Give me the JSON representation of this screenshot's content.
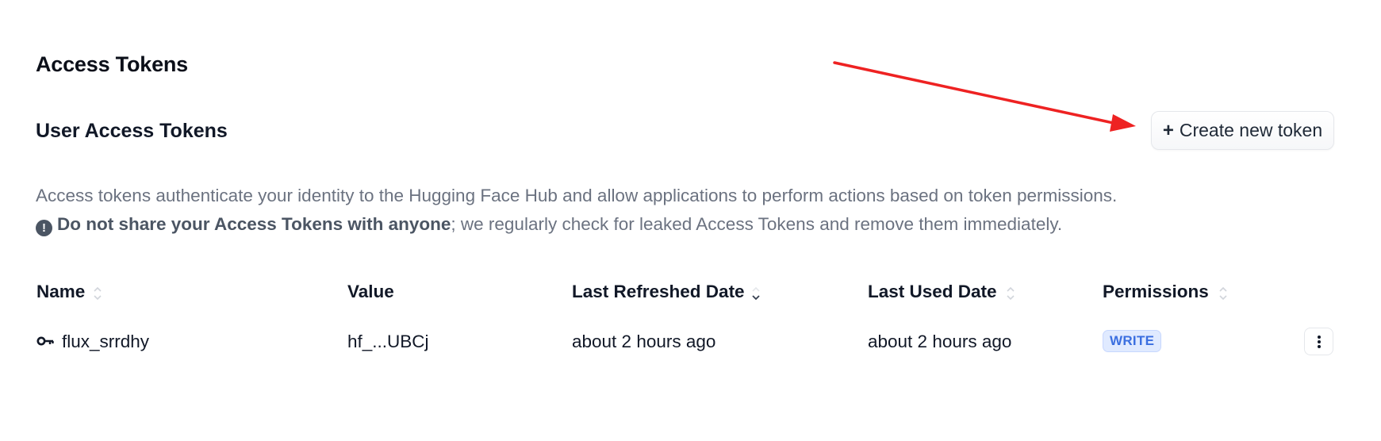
{
  "page": {
    "title": "Access Tokens"
  },
  "section": {
    "title": "User Access Tokens",
    "create_button_plus": "+",
    "create_button_label": "Create new token"
  },
  "description": {
    "line1": "Access tokens authenticate your identity to the Hugging Face Hub and allow applications to perform actions based on token permissions.",
    "warning_part1": "Do not share your ",
    "warning_bold": "Access Tokens",
    "warning_part2": " with anyone",
    "warning_rest": "; we regularly check for leaked Access Tokens and remove them immediately.",
    "warning_icon": "exclamation-circle-icon"
  },
  "table": {
    "headers": {
      "name": "Name",
      "value": "Value",
      "last_refreshed": "Last Refreshed Date",
      "last_used": "Last Used Date",
      "permissions": "Permissions"
    },
    "rows": [
      {
        "icon": "key-icon",
        "name": "flux_srrdhy",
        "value": "hf_...UBCj",
        "last_refreshed": "about 2 hours ago",
        "last_used": "about 2 hours ago",
        "permission": "WRITE"
      }
    ]
  },
  "colors": {
    "badge_bg": "#e0eaff",
    "badge_text": "#3b6fe0",
    "annotation_arrow": "#ee2222"
  }
}
